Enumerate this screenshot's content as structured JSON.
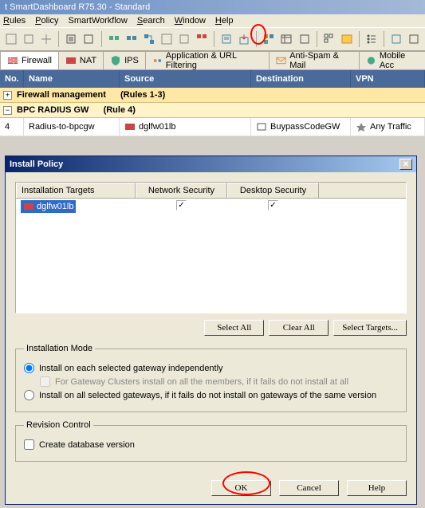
{
  "title": "t SmartDashboard R75.30 - Standard",
  "menu": {
    "rules": "Rules",
    "policy": "Policy",
    "workflow": "SmartWorkflow",
    "search": "Search",
    "window": "Window",
    "help": "Help"
  },
  "tabs": [
    {
      "label": "Firewall",
      "active": true
    },
    {
      "label": "NAT"
    },
    {
      "label": "IPS"
    },
    {
      "label": "Application & URL Filtering"
    },
    {
      "label": "Anti-Spam & Mail"
    },
    {
      "label": "Mobile Acc"
    }
  ],
  "grid": {
    "headers": {
      "no": "No.",
      "name": "Name",
      "source": "Source",
      "destination": "Destination",
      "vpn": "VPN"
    },
    "sections": [
      {
        "exp": "+",
        "title": "Firewall management",
        "range": "(Rules 1-3)"
      },
      {
        "exp": "−",
        "title": "BPC RADIUS GW",
        "range": "(Rule 4)"
      }
    ],
    "rule": {
      "no": "4",
      "name": "Radius-to-bpcgw",
      "src": "dglfw01lb",
      "dst": "BuypassCodeGW",
      "vpn": "Any Traffic"
    }
  },
  "dialog": {
    "title": "Install Policy",
    "th": {
      "targets": "Installation Targets",
      "net": "Network Security",
      "desk": "Desktop Security"
    },
    "target": "dglfw01lb",
    "chk": {
      "net": "✓",
      "desk": "✓"
    },
    "btns": {
      "selall": "Select All",
      "clrall": "Clear All",
      "seltgt": "Select Targets..."
    },
    "fs1": {
      "legend": "Installation Mode",
      "opt1": "Install on each selected gateway independently",
      "sub1": "For Gateway Clusters install on all the members, if it fails do not install at all",
      "opt2": "Install on all selected gateways, if it fails do not install on gateways of the same version"
    },
    "fs2": {
      "legend": "Revision Control",
      "opt": "Create database version"
    },
    "bottom": {
      "ok": "OK",
      "cancel": "Cancel",
      "help": "Help"
    }
  }
}
